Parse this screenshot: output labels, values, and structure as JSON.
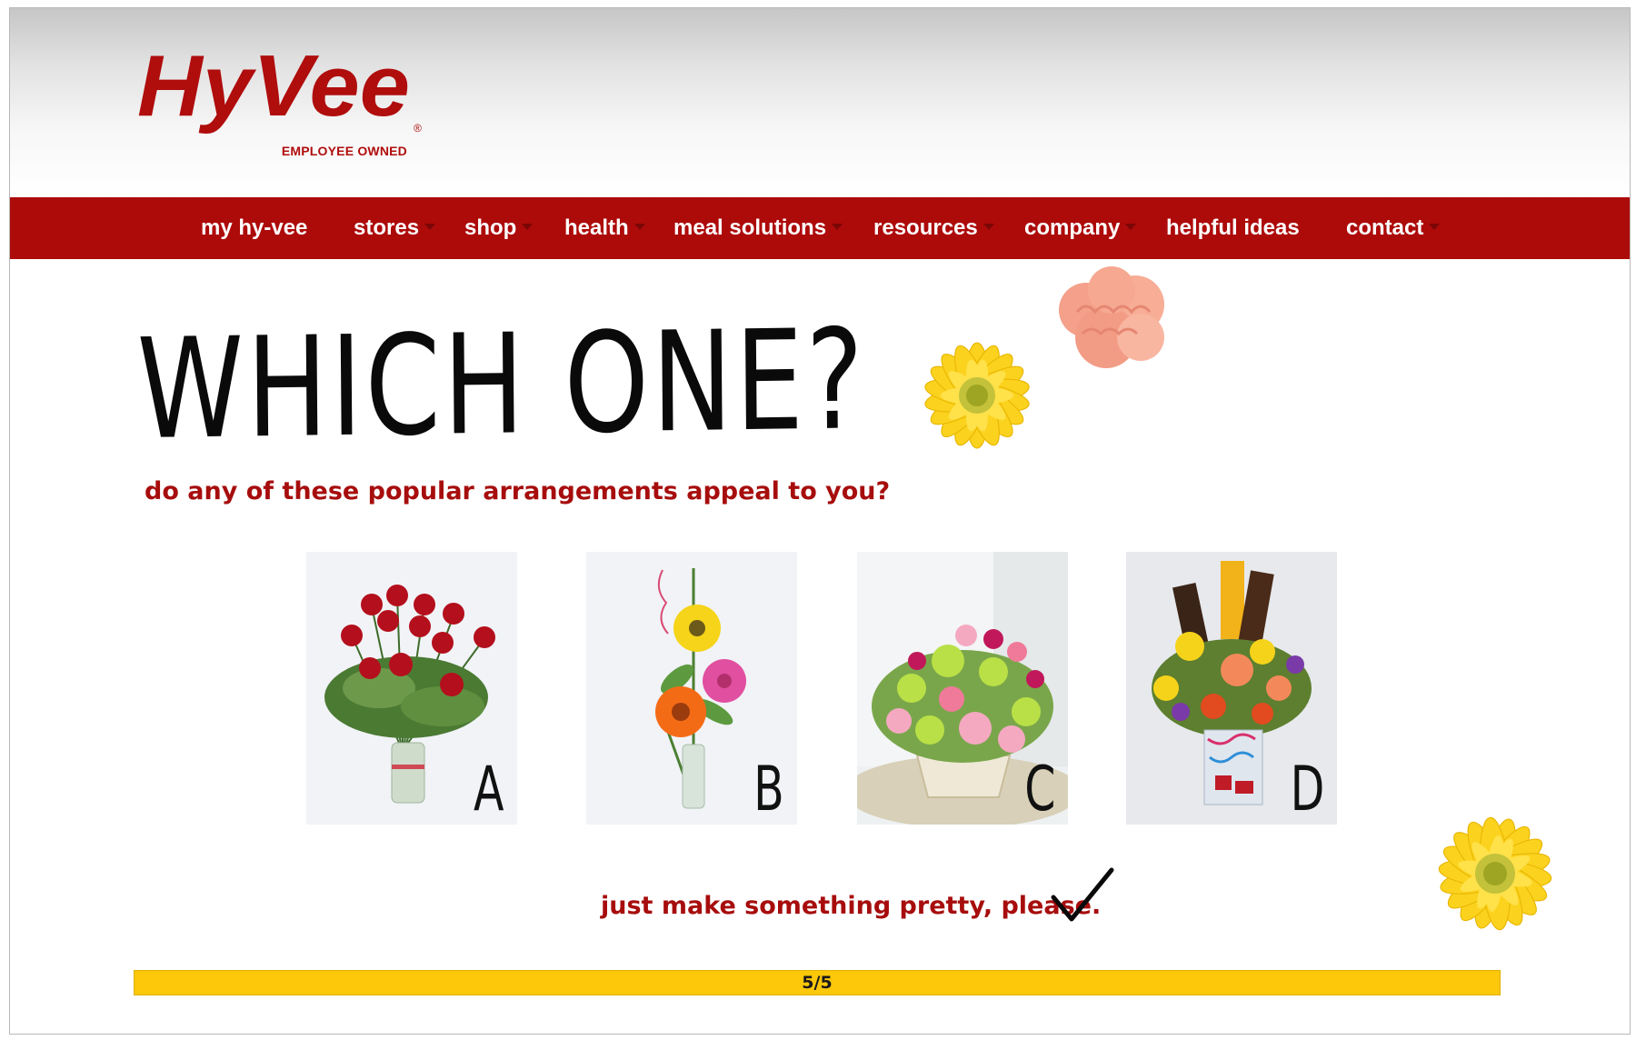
{
  "header": {
    "logo_text": "HyVee",
    "logo_subtext": "EMPLOYEE OWNED",
    "logo_mark": "®"
  },
  "nav": {
    "items": [
      {
        "label": "my hy-vee",
        "dropdown": false
      },
      {
        "label": "stores",
        "dropdown": true
      },
      {
        "label": "shop",
        "dropdown": true
      },
      {
        "label": "health",
        "dropdown": true
      },
      {
        "label": "meal solutions",
        "dropdown": true
      },
      {
        "label": "resources",
        "dropdown": true
      },
      {
        "label": "company",
        "dropdown": true
      },
      {
        "label": "helpful ideas",
        "dropdown": false
      },
      {
        "label": "contact",
        "dropdown": true
      }
    ]
  },
  "question": {
    "headline": "WHICH ONE?",
    "subtitle": "do any of these popular arrangements appeal to you?"
  },
  "options": [
    {
      "letter": "A",
      "image": "red-roses-bouquet"
    },
    {
      "letter": "B",
      "image": "gerbera-bud-vase"
    },
    {
      "letter": "C",
      "image": "mixed-flower-basket"
    },
    {
      "letter": "D",
      "image": "candy-bar-bouquet"
    }
  ],
  "default_choice": {
    "label": "just make something pretty, please.",
    "selected": true
  },
  "progress": {
    "label": "5/5",
    "fraction": 1.0
  },
  "colors": {
    "brand_red": "#ad0a0a",
    "text_red": "#a70d0d",
    "progress_yellow": "#fdc70a",
    "daisy_yellow": "#fbd21d",
    "carnation_pink": "#f6a48c"
  }
}
